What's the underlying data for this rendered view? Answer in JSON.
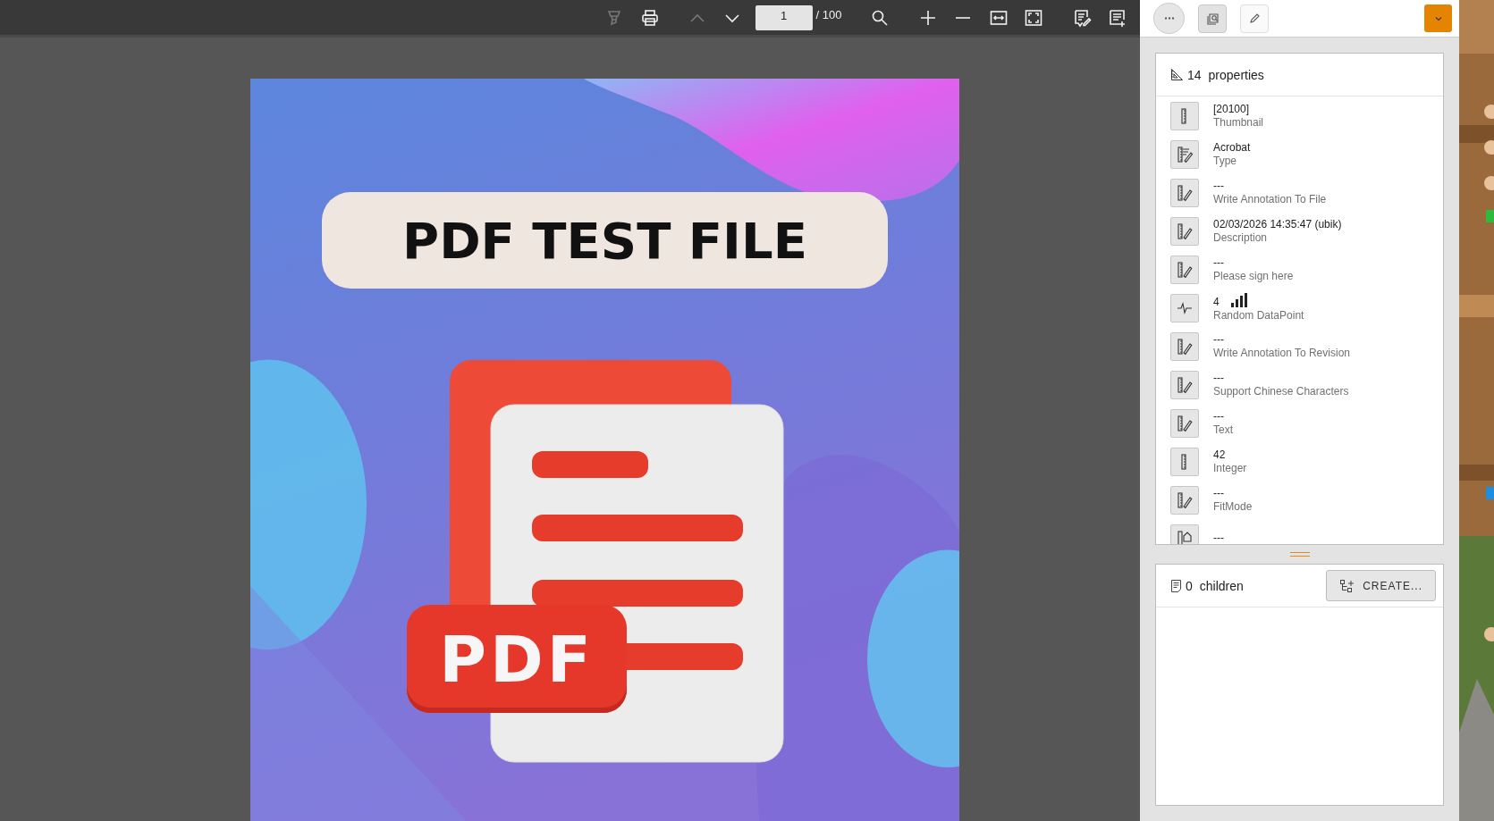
{
  "viewer_toolbar": {
    "buttons": [
      {
        "kind": "filter",
        "disabled": true
      },
      {
        "kind": "print",
        "disabled": false
      },
      {
        "kind": "previous",
        "disabled": true
      },
      {
        "kind": "next",
        "disabled": false
      },
      {
        "kind": "page",
        "value": "1",
        "total": "/ 100"
      },
      {
        "kind": "search",
        "disabled": false
      },
      {
        "kind": "zoom-in",
        "disabled": false
      },
      {
        "kind": "zoom-out",
        "disabled": false
      },
      {
        "kind": "fit-width",
        "disabled": false
      },
      {
        "kind": "fit-page",
        "disabled": false
      },
      {
        "kind": "annotate",
        "disabled": false
      },
      {
        "kind": "add-note",
        "disabled": false
      }
    ]
  },
  "document_page": {
    "title": "PDF TEST FILE",
    "badge": "PDF"
  },
  "panel_toolbar": {
    "buttons": [
      {
        "kind": "more",
        "selected": false
      },
      {
        "kind": "inspect",
        "selected": true
      },
      {
        "kind": "edit",
        "selected": false
      }
    ],
    "dropdown": {
      "kind": "caret"
    }
  },
  "properties": {
    "count": "14",
    "label": "properties",
    "items": [
      {
        "kind": "ruler",
        "value": "[20100]",
        "name": "Thumbnail"
      },
      {
        "kind": "ruler-lines-pen",
        "value": "Acrobat",
        "name": "Type"
      },
      {
        "kind": "ruler-pen",
        "value": "---",
        "name": "Write Annotation To File"
      },
      {
        "kind": "ruler-pen",
        "value": "02/03/2026 14:35:47 (ubik)",
        "name": "Description"
      },
      {
        "kind": "ruler-pen",
        "value": "---",
        "name": "Please sign here"
      },
      {
        "kind": "pulse",
        "value": "4",
        "name": "Random DataPoint",
        "signal": true
      },
      {
        "kind": "ruler-pen",
        "value": "---",
        "name": "Write Annotation To Revision"
      },
      {
        "kind": "ruler-pen",
        "value": "---",
        "name": "Support Chinese Characters"
      },
      {
        "kind": "ruler-pen",
        "value": "---",
        "name": "Text"
      },
      {
        "kind": "ruler",
        "value": "42",
        "name": "Integer"
      },
      {
        "kind": "ruler-pen",
        "value": "---",
        "name": "FitMode"
      },
      {
        "kind": "ruler-shape",
        "value": "---"
      }
    ]
  },
  "children": {
    "count": "0",
    "label": "children",
    "button": "CREATE..."
  }
}
